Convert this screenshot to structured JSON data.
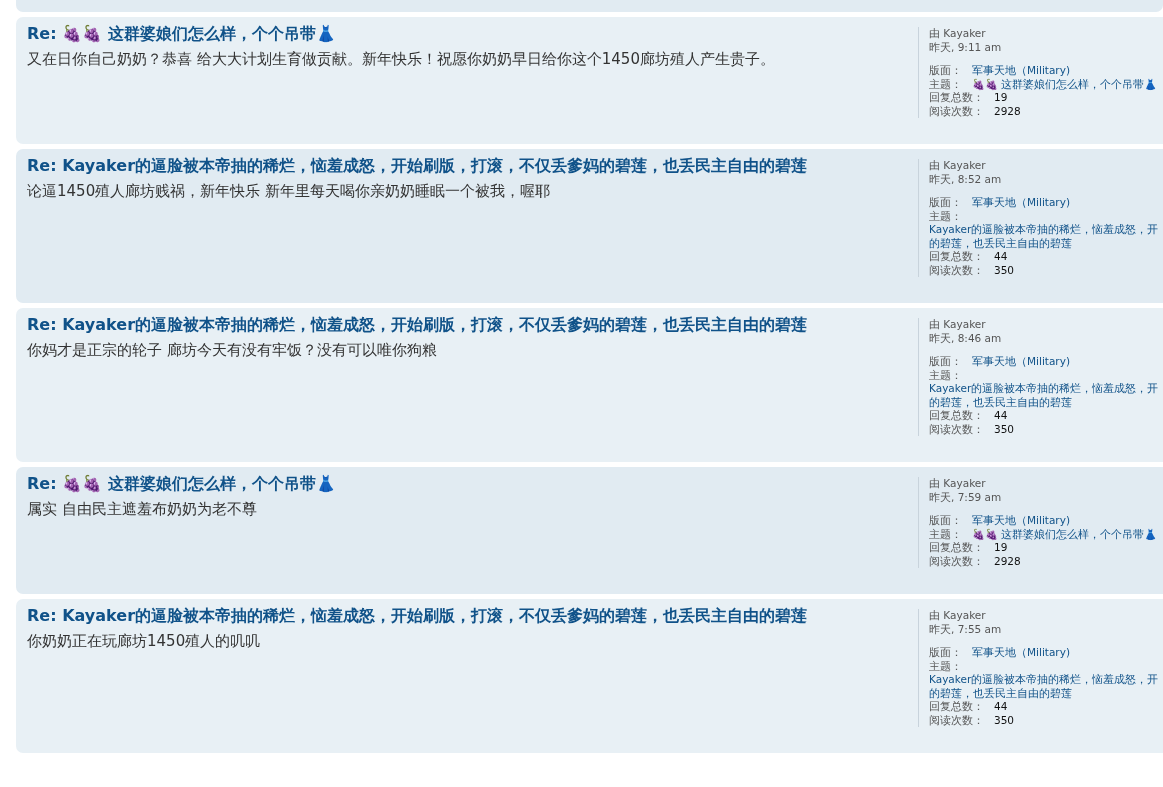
{
  "posts": [
    {
      "title": "Re: 🍇🍇 这群婆娘们怎么样，个个吊带👗",
      "body": "又在日你自己奶奶？恭喜 给大大计划生育做贡献。新年快乐！祝愿你奶奶早日给你这个1450廊坊殖人产生贵子。",
      "author_prefix": "由",
      "author": "Kayaker",
      "time": "昨天, 9:11 am",
      "forum_label": "版面：",
      "forum": "军事天地（Military)",
      "topic_label": "主题：",
      "topic_lines": [
        "🍇🍇 这群婆娘们怎么样，个个吊带👗"
      ],
      "replies_label": "回复总数：",
      "replies": "19",
      "views_label": "阅读次数：",
      "views": "2928"
    },
    {
      "title": "Re: Kayaker的逼脸被本帝抽的稀烂，恼羞成怒，开始刷版，打滚，不仅丢爹妈的碧莲，也丢民主自由的碧莲",
      "body": "论逼1450殖人廊坊贱祸，新年快乐 新年里每天喝你亲奶奶睡眠一个被我，喔耶",
      "author_prefix": "由",
      "author": "Kayaker",
      "time": "昨天, 8:52 am",
      "forum_label": "版面：",
      "forum": "军事天地（Military)",
      "topic_label": "主题：",
      "topic_lines": [
        "Kayaker的逼脸被本帝抽的稀烂，恼羞成怒，开",
        "的碧莲，也丢民主自由的碧莲"
      ],
      "replies_label": "回复总数：",
      "replies": "44",
      "views_label": "阅读次数：",
      "views": "350"
    },
    {
      "title": "Re: Kayaker的逼脸被本帝抽的稀烂，恼羞成怒，开始刷版，打滚，不仅丢爹妈的碧莲，也丢民主自由的碧莲",
      "body": "你妈才是正宗的轮子 廊坊今天有没有牢饭？没有可以唯你狗粮",
      "author_prefix": "由",
      "author": "Kayaker",
      "time": "昨天, 8:46 am",
      "forum_label": "版面：",
      "forum": "军事天地（Military)",
      "topic_label": "主题：",
      "topic_lines": [
        "Kayaker的逼脸被本帝抽的稀烂，恼羞成怒，开",
        "的碧莲，也丢民主自由的碧莲"
      ],
      "replies_label": "回复总数：",
      "replies": "44",
      "views_label": "阅读次数：",
      "views": "350"
    },
    {
      "title": "Re: 🍇🍇 这群婆娘们怎么样，个个吊带👗",
      "body": "属实 自由民主遮羞布奶奶为老不尊",
      "author_prefix": "由",
      "author": "Kayaker",
      "time": "昨天, 7:59 am",
      "forum_label": "版面：",
      "forum": "军事天地（Military)",
      "topic_label": "主题：",
      "topic_lines": [
        "🍇🍇 这群婆娘们怎么样，个个吊带👗"
      ],
      "replies_label": "回复总数：",
      "replies": "19",
      "views_label": "阅读次数：",
      "views": "2928"
    },
    {
      "title": "Re: Kayaker的逼脸被本帝抽的稀烂，恼羞成怒，开始刷版，打滚，不仅丢爹妈的碧莲，也丢民主自由的碧莲",
      "body": "你奶奶正在玩廊坊1450殖人的叽叽",
      "author_prefix": "由",
      "author": "Kayaker",
      "time": "昨天, 7:55 am",
      "forum_label": "版面：",
      "forum": "军事天地（Military)",
      "topic_label": "主题：",
      "topic_lines": [
        "Kayaker的逼脸被本帝抽的稀烂，恼羞成怒，开",
        "的碧莲，也丢民主自由的碧莲"
      ],
      "replies_label": "回复总数：",
      "replies": "44",
      "views_label": "阅读次数：",
      "views": "350"
    }
  ]
}
